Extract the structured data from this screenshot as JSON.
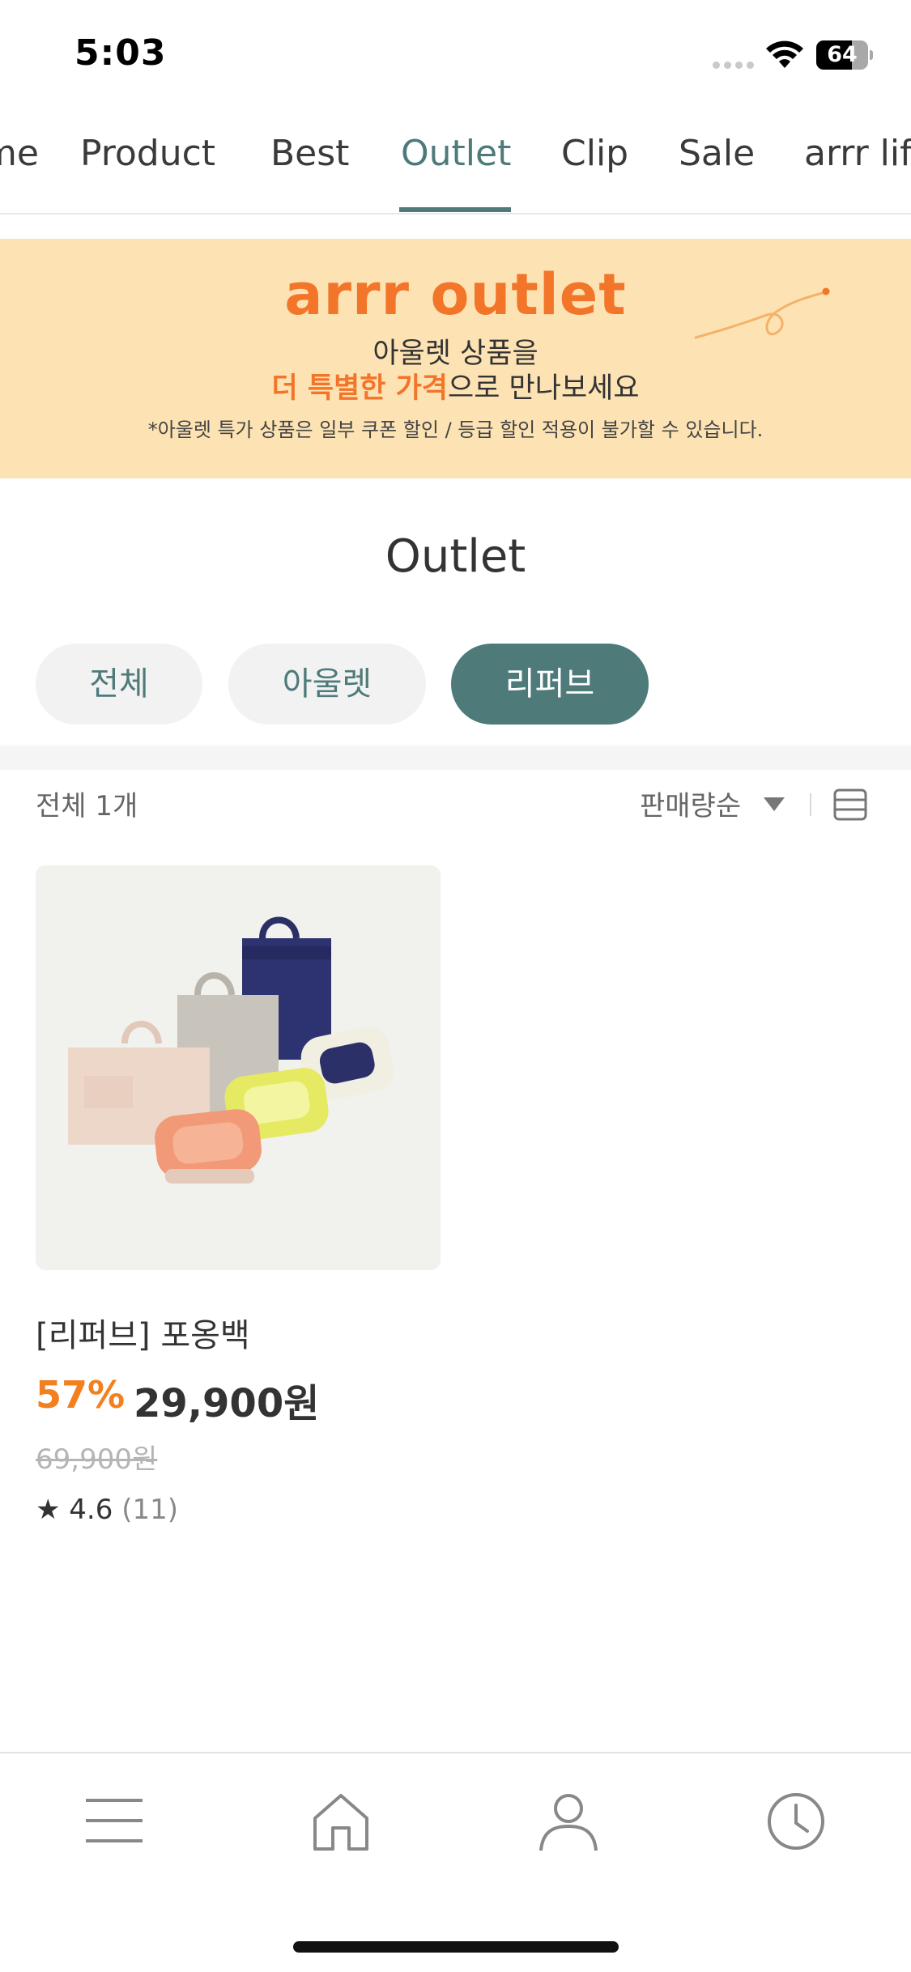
{
  "status_bar": {
    "time": "5:03",
    "battery": "64"
  },
  "top_nav": {
    "tabs": [
      {
        "label": "Home"
      },
      {
        "label": "Product"
      },
      {
        "label": "Best"
      },
      {
        "label": "Outlet",
        "active": true
      },
      {
        "label": "Clip"
      },
      {
        "label": "Sale"
      },
      {
        "label": "arrr life"
      }
    ]
  },
  "banner": {
    "title": "arrr outlet",
    "line1": "아울렛 상품을",
    "line2_highlight": "더 특별한 가격",
    "line2_rest": "으로 만나보세요",
    "note": "*아울렛 특가 상품은 일부 쿠폰 할인 / 등급 할인 적용이 불가할 수 있습니다."
  },
  "page_title": "Outlet",
  "filters": [
    {
      "label": "전체",
      "active": false
    },
    {
      "label": "아울렛",
      "active": false
    },
    {
      "label": "리퍼브",
      "active": true
    }
  ],
  "list_header": {
    "count_text": "전체 1개",
    "sort_label": "판매량순"
  },
  "products": [
    {
      "name": "[리퍼브] 포옹백",
      "discount": "57%",
      "price": "29,900원",
      "original_price": "69,900원",
      "rating_star": "★",
      "rating": "4.6",
      "review_count": "(11)"
    }
  ],
  "bottom_nav": {
    "icons": [
      "menu-icon",
      "home-icon",
      "user-icon",
      "clock-icon"
    ]
  },
  "colors": {
    "accent": "#4e7a7a",
    "orange": "#f2752a",
    "banner_bg": "#fde3b3"
  }
}
